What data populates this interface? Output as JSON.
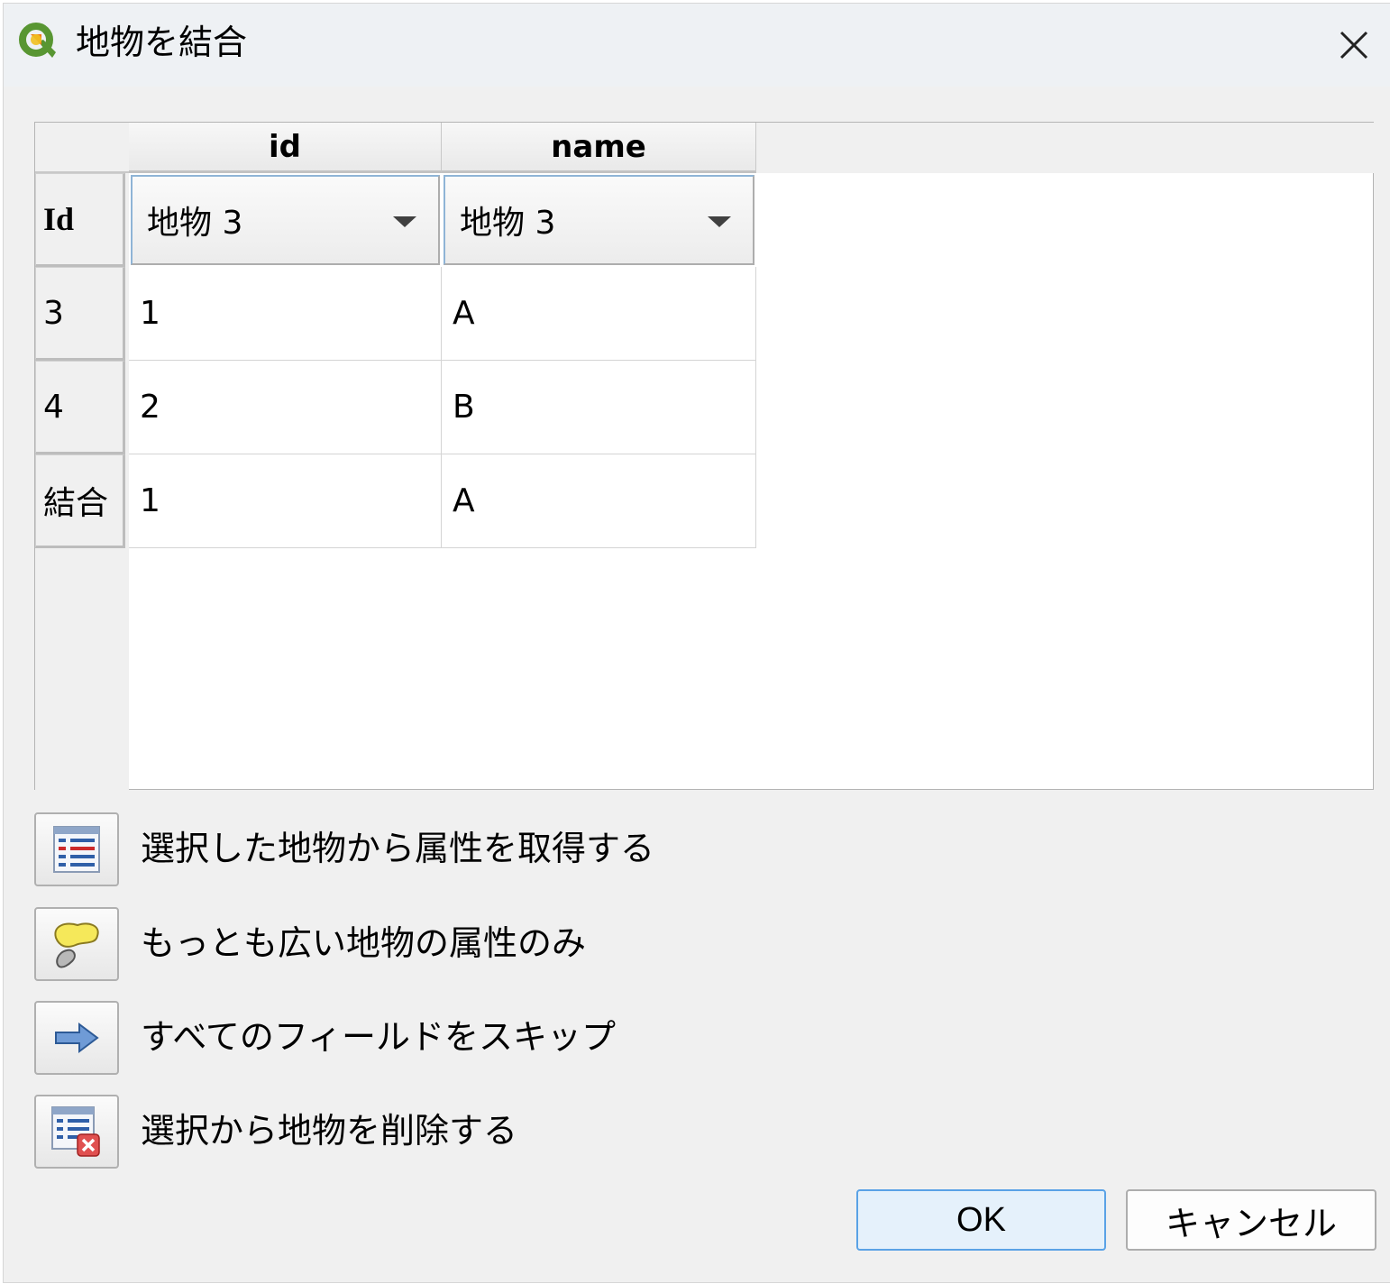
{
  "window": {
    "title": "地物を結合",
    "close_glyph": "✕"
  },
  "table": {
    "columns": [
      {
        "label": "id"
      },
      {
        "label": "name"
      }
    ],
    "selector_row": {
      "header": "Id",
      "id_value": "地物 3",
      "name_value": "地物 3"
    },
    "rows": [
      {
        "header": "3",
        "id": "1",
        "name": "A"
      },
      {
        "header": "4",
        "id": "2",
        "name": "B"
      },
      {
        "header": "結合",
        "id": "1",
        "name": "A"
      }
    ]
  },
  "actions": [
    {
      "label": "選択した地物から属性を取得する",
      "icon": "table-attributes-icon"
    },
    {
      "label": "もっとも広い地物の属性のみ",
      "icon": "largest-polygon-icon"
    },
    {
      "label": "すべてのフィールドをスキップ",
      "icon": "arrow-right-icon"
    },
    {
      "label": "選択から地物を削除する",
      "icon": "table-remove-icon"
    }
  ],
  "buttons": {
    "ok": "OK",
    "cancel": "キャンセル"
  },
  "colors": {
    "accent": "#5aa2e6",
    "titlebar": "#eef1f4",
    "dialog_bg": "#f0f0f0"
  }
}
